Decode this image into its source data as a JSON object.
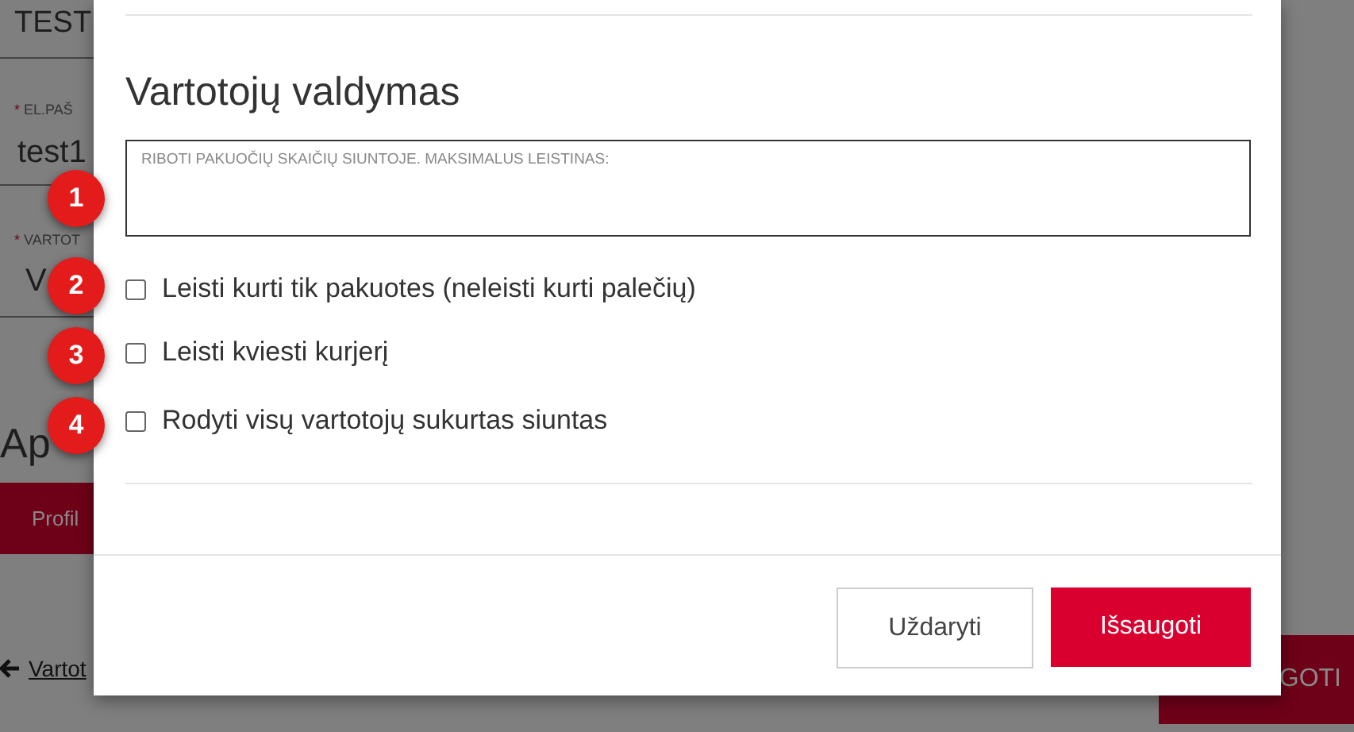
{
  "background": {
    "left_texts": [
      {
        "kind": "value",
        "text": "TEST"
      },
      {
        "kind": "label",
        "mark": "*",
        "text": "EL.PAŠ"
      },
      {
        "kind": "value",
        "text": "test1"
      },
      {
        "kind": "label",
        "mark": "*",
        "text": "VARTOT"
      },
      {
        "kind": "value",
        "text": "V"
      },
      {
        "kind": "heading",
        "text": "Ap"
      },
      {
        "kind": "tab",
        "text": "Profil"
      },
      {
        "kind": "link",
        "text": "Vartot"
      }
    ],
    "save_button": "GOTI"
  },
  "modal": {
    "title": "Vartotojų valdymas",
    "field": {
      "placeholder": "RIBOTI PAKUOČIŲ SKAIČIŲ SIUNTOJE. MAKSIMALUS LEISTINAS:"
    },
    "options": [
      {
        "label": "Leisti kurti tik pakuotes (neleisti kurti palečių)",
        "checked": false
      },
      {
        "label": "Leisti kviesti kurjerį",
        "checked": false
      },
      {
        "label": "Rodyti visų vartotojų sukurtas siuntas",
        "checked": false
      }
    ],
    "buttons": [
      {
        "label": "Uždaryti",
        "kind": "secondary"
      },
      {
        "label": "Išsaugoti",
        "kind": "primary"
      }
    ]
  },
  "markers": [
    "1",
    "2",
    "3",
    "4"
  ]
}
